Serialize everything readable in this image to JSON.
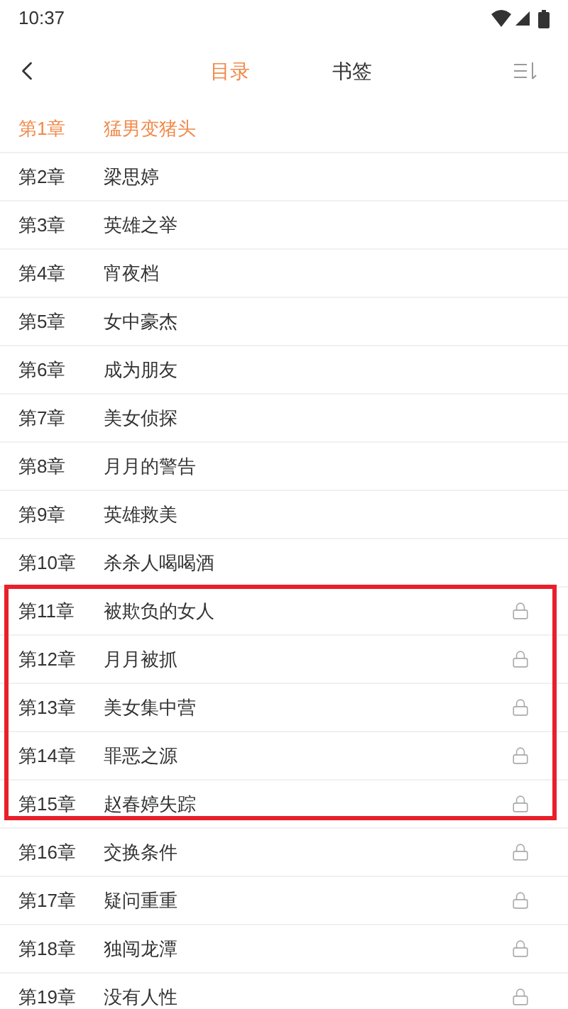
{
  "status_bar": {
    "time": "10:37"
  },
  "tabs": [
    {
      "label": "目录",
      "selected": true
    },
    {
      "label": "书签",
      "selected": false
    }
  ],
  "chapters": [
    {
      "number": "第1章",
      "title": "猛男变猪头",
      "selected": true,
      "locked": false,
      "highlighted": false
    },
    {
      "number": "第2章",
      "title": "梁思婷",
      "selected": false,
      "locked": false,
      "highlighted": false
    },
    {
      "number": "第3章",
      "title": "英雄之举",
      "selected": false,
      "locked": false,
      "highlighted": false
    },
    {
      "number": "第4章",
      "title": "宵夜档",
      "selected": false,
      "locked": false,
      "highlighted": false
    },
    {
      "number": "第5章",
      "title": "女中豪杰",
      "selected": false,
      "locked": false,
      "highlighted": false
    },
    {
      "number": "第6章",
      "title": "成为朋友",
      "selected": false,
      "locked": false,
      "highlighted": false
    },
    {
      "number": "第7章",
      "title": "美女侦探",
      "selected": false,
      "locked": false,
      "highlighted": false
    },
    {
      "number": "第8章",
      "title": "月月的警告",
      "selected": false,
      "locked": false,
      "highlighted": false
    },
    {
      "number": "第9章",
      "title": "英雄救美",
      "selected": false,
      "locked": false,
      "highlighted": false
    },
    {
      "number": "第10章",
      "title": "杀杀人喝喝酒",
      "selected": false,
      "locked": false,
      "highlighted": false
    },
    {
      "number": "第11章",
      "title": "被欺负的女人",
      "selected": false,
      "locked": true,
      "highlighted": true
    },
    {
      "number": "第12章",
      "title": "月月被抓",
      "selected": false,
      "locked": true,
      "highlighted": true
    },
    {
      "number": "第13章",
      "title": "美女集中营",
      "selected": false,
      "locked": true,
      "highlighted": true
    },
    {
      "number": "第14章",
      "title": "罪恶之源",
      "selected": false,
      "locked": true,
      "highlighted": true
    },
    {
      "number": "第15章",
      "title": "赵春婷失踪",
      "selected": false,
      "locked": true,
      "highlighted": true
    },
    {
      "number": "第16章",
      "title": "交换条件",
      "selected": false,
      "locked": true,
      "highlighted": false
    },
    {
      "number": "第17章",
      "title": "疑问重重",
      "selected": false,
      "locked": true,
      "highlighted": false
    },
    {
      "number": "第18章",
      "title": "独闯龙潭",
      "selected": false,
      "locked": true,
      "highlighted": false
    },
    {
      "number": "第19章",
      "title": "没有人性",
      "selected": false,
      "locked": true,
      "highlighted": false
    }
  ]
}
